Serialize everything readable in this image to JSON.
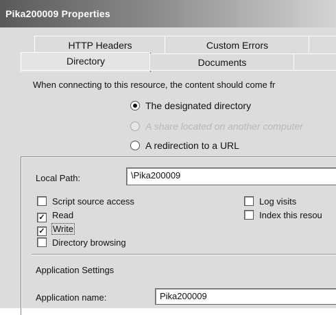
{
  "window": {
    "title": "Pika200009 Properties"
  },
  "tabs_row1": [
    {
      "label": "HTTP Headers"
    },
    {
      "label": "Custom Errors"
    }
  ],
  "tabs_row2": [
    {
      "label": "Directory",
      "active": true
    },
    {
      "label": "Documents"
    }
  ],
  "content": {
    "intro": "When connecting to this resource, the content should come fr",
    "radios": [
      {
        "label": "The designated directory",
        "selected": true,
        "enabled": true
      },
      {
        "label": "A share located on another computer",
        "selected": false,
        "enabled": false
      },
      {
        "label": "A redirection to a URL",
        "selected": false,
        "enabled": true
      }
    ]
  },
  "local_path": {
    "label": "Local Path:",
    "value": "\\Pika200009"
  },
  "checkboxes": {
    "script_source_access": {
      "label": "Script source access",
      "checked": false
    },
    "read": {
      "label": "Read",
      "checked": true
    },
    "write": {
      "label": "Write",
      "checked": true
    },
    "directory_browsing": {
      "label": "Directory browsing",
      "checked": false
    },
    "log_visits": {
      "label": "Log visits",
      "checked": false
    },
    "index_resource": {
      "label": "Index this resou",
      "checked": false
    }
  },
  "app_settings": {
    "heading": "Application Settings",
    "app_name_label": "Application name:",
    "app_name_value": "Pika200009"
  }
}
